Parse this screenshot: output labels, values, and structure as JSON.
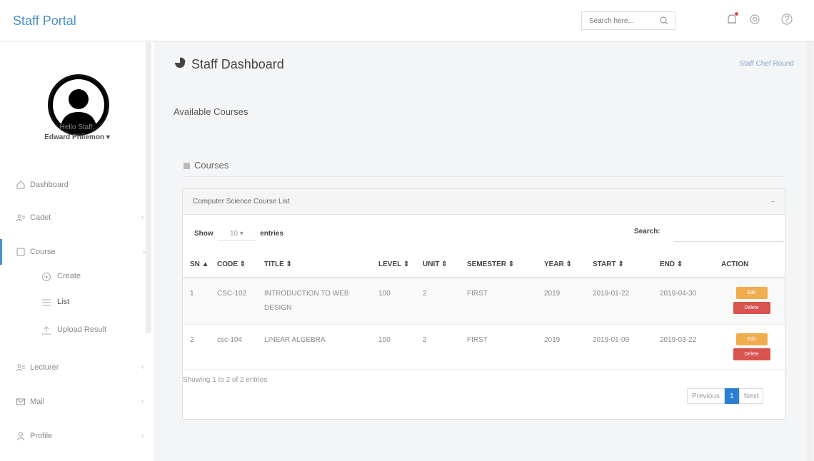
{
  "header": {
    "brand": "Staff Portal",
    "search_placeholder": "Search here..."
  },
  "sidebar": {
    "greeting": "Hello Staff,",
    "user_name": "Edward Philemon ▾",
    "items": [
      {
        "label": "Dashboard",
        "icon": "home-icon"
      },
      {
        "label": "Cadet",
        "icon": "users-icon"
      },
      {
        "label": "Course",
        "icon": "square-icon"
      },
      {
        "label": "Lecturer",
        "icon": "users-icon"
      },
      {
        "label": "Mail",
        "icon": "mail-icon"
      },
      {
        "label": "Profile",
        "icon": "user-icon"
      }
    ],
    "course_sub": [
      {
        "label": "Create",
        "icon": "plus-circle-icon"
      },
      {
        "label": "List",
        "icon": "list-icon"
      },
      {
        "label": "Upload Result",
        "icon": "upload-icon"
      }
    ]
  },
  "main": {
    "title": "Staff Dashboard",
    "top_link": "Staff Chef Round",
    "subtitle": "Available Courses",
    "section": "Courses",
    "panel_title": "Computer Science Course List",
    "collapse": "–",
    "show_label": "Show",
    "show_value": "10 ▾",
    "entries_label": "entries",
    "search_label": "Search:",
    "columns": [
      "SN ▲",
      "CODE ⇕",
      "TITLE ⇕",
      "LEVEL ⇕",
      "UNIT ⇕",
      "SEMESTER ⇕",
      "YEAR ⇕",
      "START ⇕",
      "END ⇕",
      "ACTION"
    ],
    "rows": [
      {
        "sn": "1",
        "code": "CSC-102",
        "title": "INTRODUCTION TO WEB DESIGN",
        "level": "100",
        "unit": "2",
        "semester": "FIRST",
        "year": "2019",
        "start": "2019-01-22",
        "end": "2019-04-30",
        "edit": "Edit",
        "delete": "Delete"
      },
      {
        "sn": "2",
        "code": "csc-104",
        "title": "LINEAR ALGEBRA",
        "level": "100",
        "unit": "2",
        "semester": "FIRST",
        "year": "2019",
        "start": "2019-01-09",
        "end": "2019-03-22",
        "edit": "Edit",
        "delete": "Delete"
      }
    ],
    "info": "Showing 1 to 2 of 2 entries",
    "pager": {
      "prev": "Previous",
      "current": "1",
      "next": "Next"
    }
  },
  "colors": {
    "accent": "#4a8fc9",
    "edit": "#f0ad4e",
    "delete": "#d9534f",
    "page_active": "#2a7fd4"
  }
}
